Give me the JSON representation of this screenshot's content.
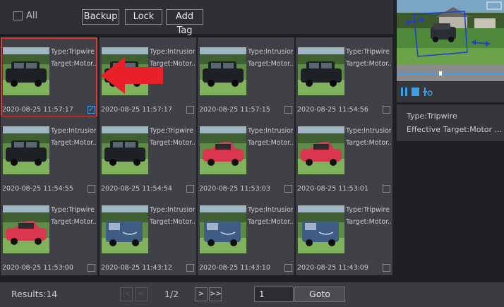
{
  "toolbar": {
    "all_label": "All",
    "backup_label": "Backup",
    "lock_label": "Lock",
    "add_tag_label": "Add Tag"
  },
  "events": [
    {
      "type": "Type:Tripwire",
      "target": "Target:Motor...",
      "time": "2020-08-25 11:57:17",
      "checked": true,
      "selected": true,
      "car_color": "#1d2024",
      "vehicle": "suv"
    },
    {
      "type": "Type:Intrusion",
      "target": "Target:Motor...",
      "time": "2020-08-25 11:57:17",
      "checked": false,
      "selected": false,
      "car_color": "#1d2024",
      "vehicle": "suv"
    },
    {
      "type": "Type:Intrusion",
      "target": "Target:Motor...",
      "time": "2020-08-25 11:57:15",
      "checked": false,
      "selected": false,
      "car_color": "#1d2024",
      "vehicle": "suv"
    },
    {
      "type": "Type:Tripwire",
      "target": "Target:Motor...",
      "time": "2020-08-25 11:54:56",
      "checked": false,
      "selected": false,
      "car_color": "#1d2024",
      "vehicle": "suv"
    },
    {
      "type": "Type:Intrusion",
      "target": "Target:Motor...",
      "time": "2020-08-25 11:54:55",
      "checked": false,
      "selected": false,
      "car_color": "#1d2024",
      "vehicle": "suv"
    },
    {
      "type": "Type:Tripwire",
      "target": "Target:Motor...",
      "time": "2020-08-25 11:54:54",
      "checked": false,
      "selected": false,
      "car_color": "#1d2024",
      "vehicle": "suv"
    },
    {
      "type": "Type:Intrusion",
      "target": "Target:Motor...",
      "time": "2020-08-25 11:53:03",
      "checked": false,
      "selected": false,
      "car_color": "#d9364f",
      "vehicle": "car"
    },
    {
      "type": "Type:Intrusion",
      "target": "Target:Motor...",
      "time": "2020-08-25 11:53:01",
      "checked": false,
      "selected": false,
      "car_color": "#d9364f",
      "vehicle": "car"
    },
    {
      "type": "Type:Tripwire",
      "target": "Target:Motor...",
      "time": "2020-08-25 11:53:00",
      "checked": false,
      "selected": false,
      "car_color": "#d9364f",
      "vehicle": "car"
    },
    {
      "type": "Type:Intrusion",
      "target": "Target:Motor...",
      "time": "2020-08-25 11:43:12",
      "checked": false,
      "selected": false,
      "car_color": "#3f5c82",
      "vehicle": "van"
    },
    {
      "type": "Type:Intrusion",
      "target": "Target:Motor...",
      "time": "2020-08-25 11:43:10",
      "checked": false,
      "selected": false,
      "car_color": "#3f5c82",
      "vehicle": "van"
    },
    {
      "type": "Type:Tripwire",
      "target": "Target:Motor...",
      "time": "2020-08-25 11:43:09",
      "checked": false,
      "selected": false,
      "car_color": "#3f5c82",
      "vehicle": "van"
    }
  ],
  "details": {
    "type": "Type:Tripwire",
    "target": "Effective Target:Motor ..."
  },
  "pagination": {
    "results": "Results:14",
    "page_info": "1/2",
    "first_label": "|<",
    "prev_label": "<",
    "next_label": ">",
    "last_label": ">>",
    "page_value": "1",
    "goto_label": "Goto"
  },
  "colors": {
    "accent": "#3aa0e8",
    "selection": "#d93a3a",
    "arrow": "#e8202a"
  }
}
